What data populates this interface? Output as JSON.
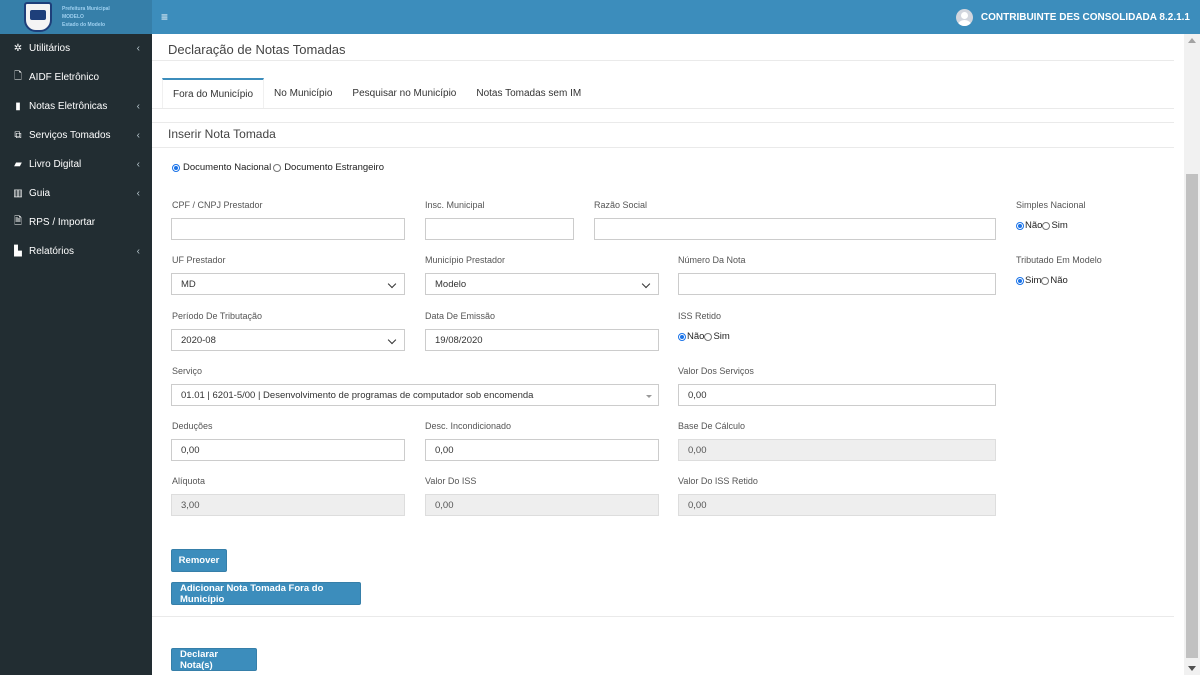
{
  "brand": {
    "line1": "Prefeitura Municipal",
    "line2": "MODELO",
    "line3": "Estado do Modelo"
  },
  "sidebar": {
    "items": [
      {
        "label": "Utilitários",
        "icon": "gear-icon",
        "glyph": "✲",
        "has_submenu": true
      },
      {
        "label": "AIDF Eletrônico",
        "icon": "document-icon",
        "glyph": "🗋",
        "has_submenu": false
      },
      {
        "label": "Notas Eletrônicas",
        "icon": "file-icon",
        "glyph": "▮",
        "has_submenu": true
      },
      {
        "label": "Serviços Tomados",
        "icon": "copy-icon",
        "glyph": "⧉",
        "has_submenu": true
      },
      {
        "label": "Livro Digital",
        "icon": "book-icon",
        "glyph": "▰",
        "has_submenu": true
      },
      {
        "label": "Guia",
        "icon": "barcode-icon",
        "glyph": "▥",
        "has_submenu": true
      },
      {
        "label": "RPS / Importar",
        "icon": "file-text-icon",
        "glyph": "🗎",
        "has_submenu": false
      },
      {
        "label": "Relatórios",
        "icon": "bar-chart-icon",
        "glyph": "▙",
        "has_submenu": true
      }
    ],
    "chevron": "‹"
  },
  "header": {
    "menu_glyph": "≡",
    "user_name": "CONTRIBUINTE DES CONSOLIDADA 8.2.1.1"
  },
  "page": {
    "title": "Declaração de Notas Tomadas"
  },
  "tabs": [
    {
      "label": "Fora do Município",
      "active": true
    },
    {
      "label": "No Município",
      "active": false
    },
    {
      "label": "Pesquisar no Município",
      "active": false
    },
    {
      "label": "Notas Tomadas sem IM",
      "active": false
    }
  ],
  "form": {
    "section_title": "Inserir Nota Tomada",
    "doc_type": {
      "nacional": "Documento Nacional",
      "estrangeiro": "Documento Estrangeiro",
      "selected": "nacional"
    },
    "cpf_cnpj": {
      "label": "CPF / CNPJ Prestador",
      "value": ""
    },
    "insc_municipal": {
      "label": "Insc. Municipal",
      "value": ""
    },
    "razao_social": {
      "label": "Razão Social",
      "value": ""
    },
    "simples_nacional": {
      "label": "Simples Nacional",
      "opt1": "Não",
      "opt2": "Sim",
      "selected": "Não"
    },
    "uf_prestador": {
      "label": "UF Prestador",
      "value": "MD"
    },
    "municipio_prestador": {
      "label": "Município Prestador",
      "value": "Modelo"
    },
    "numero_nota": {
      "label": "Número Da Nota",
      "value": ""
    },
    "tributado_modelo": {
      "label": "Tributado Em Modelo",
      "opt1": "Sim",
      "opt2": "Não",
      "selected": "Sim"
    },
    "periodo": {
      "label": "Período De Tributação",
      "value": "2020-08"
    },
    "data_emissao": {
      "label": "Data De Emissão",
      "value": "19/08/2020"
    },
    "iss_retido": {
      "label": "ISS Retido",
      "opt1": "Não",
      "opt2": "Sim",
      "selected": "Não"
    },
    "servico": {
      "label": "Serviço",
      "value": "01.01 | 6201-5/00 | Desenvolvimento de programas de computador sob encomenda"
    },
    "valor_servicos": {
      "label": "Valor Dos Serviços",
      "value": "0,00"
    },
    "deducoes": {
      "label": "Deduções",
      "value": "0,00"
    },
    "desc_incondicionado": {
      "label": "Desc. Incondicionado",
      "value": "0,00"
    },
    "base_calculo": {
      "label": "Base De Cálculo",
      "value": "0,00"
    },
    "aliquota": {
      "label": "Alíquota",
      "value": "3,00"
    },
    "valor_iss": {
      "label": "Valor Do ISS",
      "value": "0,00"
    },
    "valor_iss_retido": {
      "label": "Valor Do ISS Retido",
      "value": "0,00"
    }
  },
  "buttons": {
    "remover": "Remover",
    "adicionar": "Adicionar Nota Tomada Fora do Município",
    "declarar": "Declarar Nota(s)"
  }
}
